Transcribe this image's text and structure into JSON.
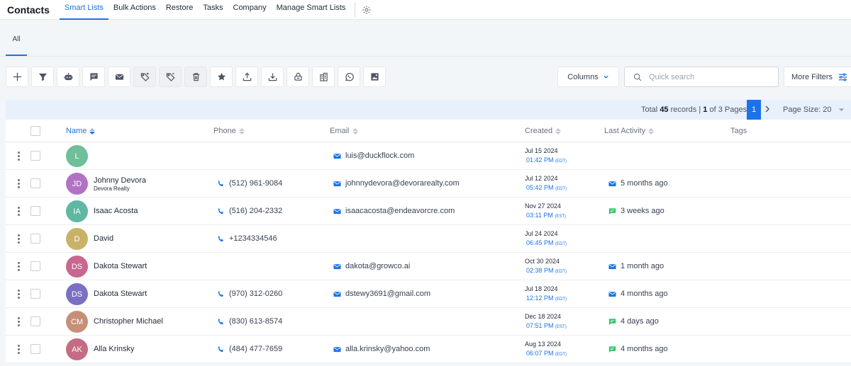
{
  "app": {
    "title": "Contacts"
  },
  "nav": {
    "tabs": [
      {
        "label": "Smart Lists",
        "active": true
      },
      {
        "label": "Bulk Actions",
        "active": false
      },
      {
        "label": "Restore",
        "active": false
      },
      {
        "label": "Tasks",
        "active": false
      },
      {
        "label": "Company",
        "active": false
      },
      {
        "label": "Manage Smart Lists",
        "active": false
      }
    ],
    "settings_icon": "gear-icon"
  },
  "subtabs": [
    {
      "label": "All",
      "active": true
    }
  ],
  "toolbar": {
    "buttons": [
      {
        "name": "add-contact-button",
        "icon": "plus-icon"
      },
      {
        "name": "filter-button",
        "icon": "filter-icon"
      },
      {
        "name": "workflow-button",
        "icon": "robot-icon"
      },
      {
        "name": "sms-button",
        "icon": "message-icon"
      },
      {
        "name": "email-button",
        "icon": "envelope-icon"
      },
      {
        "name": "add-tag-button",
        "icon": "tag-plus-icon"
      },
      {
        "name": "remove-tag-button",
        "icon": "tag-minus-icon"
      },
      {
        "name": "delete-button",
        "icon": "trash-icon"
      },
      {
        "name": "review-button",
        "icon": "star-icon"
      },
      {
        "name": "export-button",
        "icon": "upload-icon"
      },
      {
        "name": "import-button",
        "icon": "download-icon"
      },
      {
        "name": "merge-button",
        "icon": "merge-icon"
      },
      {
        "name": "company-button",
        "icon": "building-icon"
      },
      {
        "name": "whatsapp-button",
        "icon": "whatsapp-icon"
      },
      {
        "name": "image-button",
        "icon": "image-icon"
      }
    ],
    "columns_label": "Columns",
    "search_placeholder": "Quick search",
    "more_filters_label": "More Filters"
  },
  "pager": {
    "total_prefix": "Total",
    "total_records": "45",
    "total_suffix": "records |",
    "current_page": "1",
    "pages_suffix": "of 3 Pages",
    "active_page": "1",
    "page_size_label": "Page Size: 20"
  },
  "table": {
    "headers": {
      "name": "Name",
      "phone": "Phone",
      "email": "Email",
      "created": "Created",
      "last_activity": "Last Activity",
      "tags": "Tags"
    },
    "rows": [
      {
        "initials": "L",
        "avatar_color": "#6fbf9a",
        "name": "",
        "company": "",
        "phone": "",
        "email": "luis@duckflock.com",
        "created_date": "Jul 15 2024",
        "created_time": "01:42 PM",
        "tz": "(EDT)",
        "activity": "",
        "activity_icon": ""
      },
      {
        "initials": "JD",
        "avatar_color": "#b172c5",
        "name": "Johnny Devora",
        "company": "Devora Realty",
        "phone": "(512) 961-9084",
        "email": "johnnydevora@devorarealty.com",
        "created_date": "Jul 12 2024",
        "created_time": "05:42 PM",
        "tz": "(EDT)",
        "activity": "5 months ago",
        "activity_icon": "envelope"
      },
      {
        "initials": "IA",
        "avatar_color": "#5fb8a2",
        "name": "Isaac Acosta",
        "company": "",
        "phone": "(516) 204-2332",
        "email": "isaacacosta@endeavorcre.com",
        "created_date": "Nov 27 2024",
        "created_time": "03:11 PM",
        "tz": "(EST)",
        "activity": "3 weeks ago",
        "activity_icon": "sms"
      },
      {
        "initials": "D",
        "avatar_color": "#c9b268",
        "name": "David",
        "company": "",
        "phone": "+1234334546",
        "email": "",
        "created_date": "Jul 24 2024",
        "created_time": "06:45 PM",
        "tz": "(EDT)",
        "activity": "",
        "activity_icon": ""
      },
      {
        "initials": "DS",
        "avatar_color": "#c8678f",
        "name": "Dakota Stewart",
        "company": "",
        "phone": "",
        "email": "dakota@growco.ai",
        "created_date": "Oct 30 2024",
        "created_time": "02:38 PM",
        "tz": "(EDT)",
        "activity": "1 month ago",
        "activity_icon": "envelope"
      },
      {
        "initials": "DS",
        "avatar_color": "#7b6fc4",
        "name": "Dakota Stewart",
        "company": "",
        "phone": "(970) 312-0260",
        "email": "dstewy3691@gmail.com",
        "created_date": "Jul 18 2024",
        "created_time": "12:12 PM",
        "tz": "(EDT)",
        "activity": "4 months ago",
        "activity_icon": "envelope"
      },
      {
        "initials": "CM",
        "avatar_color": "#c69076",
        "name": "Christopher Michael",
        "company": "",
        "phone": "(830) 613-8574",
        "email": "",
        "created_date": "Dec 18 2024",
        "created_time": "07:51 PM",
        "tz": "(EST)",
        "activity": "4 days ago",
        "activity_icon": "sms"
      },
      {
        "initials": "AK",
        "avatar_color": "#c46c84",
        "name": "Alla Krinsky",
        "company": "",
        "phone": "(484) 477-7659",
        "email": "alla.krinsky@yahoo.com",
        "created_date": "Aug 13 2024",
        "created_time": "06:07 PM",
        "tz": "(EDT)",
        "activity": "4 months ago",
        "activity_icon": "sms"
      }
    ]
  },
  "colors": {
    "accent": "#1a73e8",
    "sms_green": "#22c55e"
  }
}
